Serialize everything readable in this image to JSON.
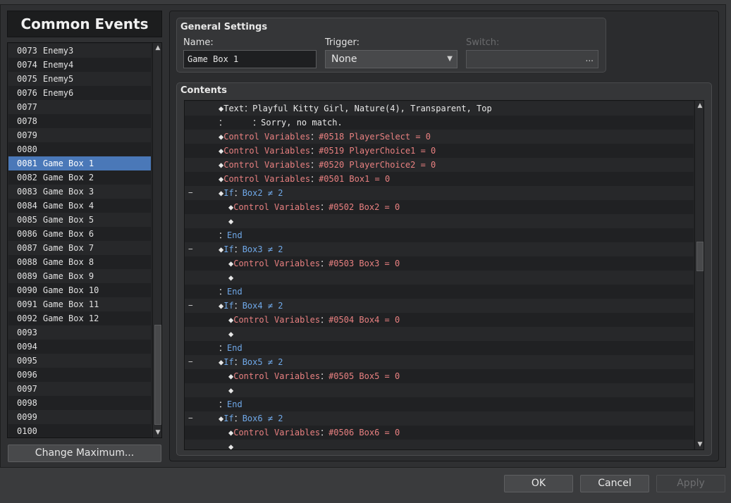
{
  "left_panel": {
    "title": "Common Events",
    "events": [
      {
        "id": "0073",
        "name": "Enemy3"
      },
      {
        "id": "0074",
        "name": "Enemy4"
      },
      {
        "id": "0075",
        "name": "Enemy5"
      },
      {
        "id": "0076",
        "name": "Enemy6"
      },
      {
        "id": "0077",
        "name": ""
      },
      {
        "id": "0078",
        "name": ""
      },
      {
        "id": "0079",
        "name": ""
      },
      {
        "id": "0080",
        "name": ""
      },
      {
        "id": "0081",
        "name": "Game Box 1",
        "selected": true
      },
      {
        "id": "0082",
        "name": "Game Box 2"
      },
      {
        "id": "0083",
        "name": "Game Box 3"
      },
      {
        "id": "0084",
        "name": "Game Box 4"
      },
      {
        "id": "0085",
        "name": "Game Box 5"
      },
      {
        "id": "0086",
        "name": "Game Box 6"
      },
      {
        "id": "0087",
        "name": "Game Box 7"
      },
      {
        "id": "0088",
        "name": "Game Box 8"
      },
      {
        "id": "0089",
        "name": "Game Box 9"
      },
      {
        "id": "0090",
        "name": "Game Box 10"
      },
      {
        "id": "0091",
        "name": "Game Box 11"
      },
      {
        "id": "0092",
        "name": "Game Box 12"
      },
      {
        "id": "0093",
        "name": ""
      },
      {
        "id": "0094",
        "name": ""
      },
      {
        "id": "0095",
        "name": ""
      },
      {
        "id": "0096",
        "name": ""
      },
      {
        "id": "0097",
        "name": ""
      },
      {
        "id": "0098",
        "name": ""
      },
      {
        "id": "0099",
        "name": ""
      },
      {
        "id": "0100",
        "name": ""
      }
    ],
    "change_max_label": "Change Maximum..."
  },
  "general": {
    "title": "General Settings",
    "name_label": "Name:",
    "name_value": "Game Box 1",
    "trigger_label": "Trigger:",
    "trigger_value": "None",
    "switch_label": "Switch:",
    "switch_button": "..."
  },
  "contents": {
    "title": "Contents",
    "commands": [
      {
        "indent": 0,
        "collapse": "",
        "parts": [
          [
            "dia",
            "◆"
          ],
          [
            "c-white",
            "Text"
          ],
          [
            "c-colon",
            "："
          ],
          [
            "c-white",
            "Playful Kitty Girl, Nature(4), Transparent, Top"
          ]
        ]
      },
      {
        "indent": 0,
        "collapse": "",
        "parts": [
          [
            "c-colon",
            "：     ："
          ],
          [
            "c-white",
            "Sorry, no match."
          ]
        ]
      },
      {
        "indent": 0,
        "collapse": "",
        "parts": [
          [
            "dia",
            "◆"
          ],
          [
            "c-red",
            "Control Variables"
          ],
          [
            "c-colon",
            "："
          ],
          [
            "c-red",
            "#0518 PlayerSelect = 0"
          ]
        ]
      },
      {
        "indent": 0,
        "collapse": "",
        "parts": [
          [
            "dia",
            "◆"
          ],
          [
            "c-red",
            "Control Variables"
          ],
          [
            "c-colon",
            "："
          ],
          [
            "c-red",
            "#0519 PlayerChoice1 = 0"
          ]
        ]
      },
      {
        "indent": 0,
        "collapse": "",
        "parts": [
          [
            "dia",
            "◆"
          ],
          [
            "c-red",
            "Control Variables"
          ],
          [
            "c-colon",
            "："
          ],
          [
            "c-red",
            "#0520 PlayerChoice2 = 0"
          ]
        ]
      },
      {
        "indent": 0,
        "collapse": "",
        "parts": [
          [
            "dia",
            "◆"
          ],
          [
            "c-red",
            "Control Variables"
          ],
          [
            "c-colon",
            "："
          ],
          [
            "c-red",
            "#0501 Box1 = 0"
          ]
        ]
      },
      {
        "indent": 0,
        "collapse": "−",
        "parts": [
          [
            "dia",
            "◆"
          ],
          [
            "c-blue",
            "If"
          ],
          [
            "c-colon",
            "："
          ],
          [
            "c-blue",
            "Box2 ≠ 2"
          ]
        ]
      },
      {
        "indent": 1,
        "collapse": "",
        "parts": [
          [
            "dia",
            "◆"
          ],
          [
            "c-red",
            "Control Variables"
          ],
          [
            "c-colon",
            "："
          ],
          [
            "c-red",
            "#0502 Box2 = 0"
          ]
        ]
      },
      {
        "indent": 1,
        "collapse": "",
        "parts": [
          [
            "dia",
            "◆"
          ]
        ]
      },
      {
        "indent": 0,
        "collapse": "",
        "parts": [
          [
            "c-colon",
            "："
          ],
          [
            "c-blue",
            "End"
          ]
        ]
      },
      {
        "indent": 0,
        "collapse": "−",
        "parts": [
          [
            "dia",
            "◆"
          ],
          [
            "c-blue",
            "If"
          ],
          [
            "c-colon",
            "："
          ],
          [
            "c-blue",
            "Box3 ≠ 2"
          ]
        ]
      },
      {
        "indent": 1,
        "collapse": "",
        "parts": [
          [
            "dia",
            "◆"
          ],
          [
            "c-red",
            "Control Variables"
          ],
          [
            "c-colon",
            "："
          ],
          [
            "c-red",
            "#0503 Box3 = 0"
          ]
        ]
      },
      {
        "indent": 1,
        "collapse": "",
        "parts": [
          [
            "dia",
            "◆"
          ]
        ]
      },
      {
        "indent": 0,
        "collapse": "",
        "parts": [
          [
            "c-colon",
            "："
          ],
          [
            "c-blue",
            "End"
          ]
        ]
      },
      {
        "indent": 0,
        "collapse": "−",
        "parts": [
          [
            "dia",
            "◆"
          ],
          [
            "c-blue",
            "If"
          ],
          [
            "c-colon",
            "："
          ],
          [
            "c-blue",
            "Box4 ≠ 2"
          ]
        ]
      },
      {
        "indent": 1,
        "collapse": "",
        "parts": [
          [
            "dia",
            "◆"
          ],
          [
            "c-red",
            "Control Variables"
          ],
          [
            "c-colon",
            "："
          ],
          [
            "c-red",
            "#0504 Box4 = 0"
          ]
        ]
      },
      {
        "indent": 1,
        "collapse": "",
        "parts": [
          [
            "dia",
            "◆"
          ]
        ]
      },
      {
        "indent": 0,
        "collapse": "",
        "parts": [
          [
            "c-colon",
            "："
          ],
          [
            "c-blue",
            "End"
          ]
        ]
      },
      {
        "indent": 0,
        "collapse": "−",
        "parts": [
          [
            "dia",
            "◆"
          ],
          [
            "c-blue",
            "If"
          ],
          [
            "c-colon",
            "："
          ],
          [
            "c-blue",
            "Box5 ≠ 2"
          ]
        ]
      },
      {
        "indent": 1,
        "collapse": "",
        "parts": [
          [
            "dia",
            "◆"
          ],
          [
            "c-red",
            "Control Variables"
          ],
          [
            "c-colon",
            "："
          ],
          [
            "c-red",
            "#0505 Box5 = 0"
          ]
        ]
      },
      {
        "indent": 1,
        "collapse": "",
        "parts": [
          [
            "dia",
            "◆"
          ]
        ]
      },
      {
        "indent": 0,
        "collapse": "",
        "parts": [
          [
            "c-colon",
            "："
          ],
          [
            "c-blue",
            "End"
          ]
        ]
      },
      {
        "indent": 0,
        "collapse": "−",
        "parts": [
          [
            "dia",
            "◆"
          ],
          [
            "c-blue",
            "If"
          ],
          [
            "c-colon",
            "："
          ],
          [
            "c-blue",
            "Box6 ≠ 2"
          ]
        ]
      },
      {
        "indent": 1,
        "collapse": "",
        "parts": [
          [
            "dia",
            "◆"
          ],
          [
            "c-red",
            "Control Variables"
          ],
          [
            "c-colon",
            "："
          ],
          [
            "c-red",
            "#0506 Box6 = 0"
          ]
        ]
      },
      {
        "indent": 1,
        "collapse": "",
        "parts": [
          [
            "dia",
            "◆"
          ]
        ]
      }
    ]
  },
  "buttons": {
    "ok": "OK",
    "cancel": "Cancel",
    "apply": "Apply"
  },
  "scroll_arrows": {
    "up": "▲",
    "down": "▼"
  },
  "trigger_arrow": "▼",
  "colors": {
    "selection": "#4a78b8",
    "command_red": "#e88080",
    "command_blue": "#6fa8e8"
  }
}
